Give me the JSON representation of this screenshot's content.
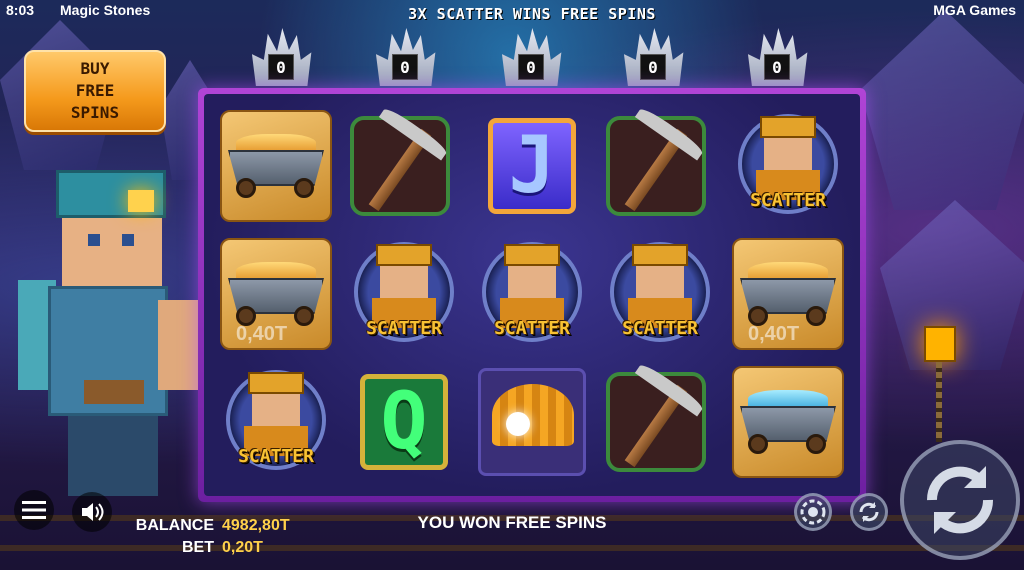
{
  "status_bar": {
    "time": "8:03",
    "game_title": "Magic Stones",
    "provider": "MGA Games"
  },
  "banner": "3X SCATTER WINS FREE SPINS",
  "scatter_counters": [
    "0",
    "0",
    "0",
    "0",
    "0"
  ],
  "buy_button": {
    "line1": "BUY",
    "line2": "FREE",
    "line3": "SPINS"
  },
  "reels": [
    [
      "gold-cart",
      "gold-cart",
      "scatter"
    ],
    [
      "pickaxe",
      "scatter",
      "letter-q"
    ],
    [
      "letter-j",
      "scatter",
      "helmet"
    ],
    [
      "pickaxe",
      "scatter",
      "pickaxe"
    ],
    [
      "scatter",
      "gold-cart",
      "diamond-cart"
    ]
  ],
  "symbol_text": {
    "scatter": "SCATTER",
    "letter_j": "J",
    "letter_q": "Q",
    "cart_value": "0,40T"
  },
  "hud": {
    "balance_label": "BALANCE",
    "balance_value": "4982,80T",
    "bet_label": "BET",
    "bet_value": "0,20T",
    "message": "YOU WON FREE SPINS"
  },
  "colors": {
    "frame": "#a33dd1",
    "accent_gold": "#ffd14a",
    "buy_button": "#f59a1c"
  },
  "icons": {
    "menu": "hamburger-icon",
    "sound": "speaker-icon",
    "autoplay": "chip-icon",
    "turbo": "refresh-icon",
    "spin": "spin-icon"
  }
}
